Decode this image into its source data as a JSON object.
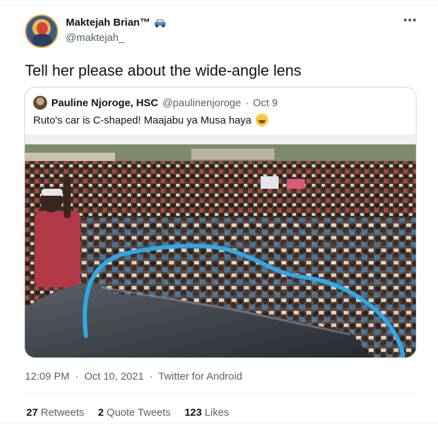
{
  "tweet": {
    "author_name": "Maktejah Brian™",
    "author_handle": "@maktejah_",
    "text": "Tell her please about the wide-angle lens",
    "more_icon": "more-horizontal-icon",
    "name_icon": "car-icon"
  },
  "quoted_tweet": {
    "author_name": "Pauline Njoroge, HSC",
    "author_handle": "@paulinenjoroge",
    "separator": "·",
    "date": "Oct 9",
    "text": "Ruto's car is C-shaped! Maajabu ya Musa haya",
    "emoji": "rolling-on-floor-laughing-emoji"
  },
  "meta": {
    "time": "12:09 PM",
    "separator": "·",
    "date": "Oct 10, 2021",
    "source": "Twitter for Android"
  },
  "stats": [
    {
      "count": "27",
      "label": "Retweets"
    },
    {
      "count": "2",
      "label": "Quote Tweets"
    },
    {
      "count": "123",
      "label": "Likes"
    }
  ],
  "colors": {
    "highlight_outline": "#2fa8e6",
    "secondary_text": "#536471",
    "border": "#cfd9de"
  }
}
